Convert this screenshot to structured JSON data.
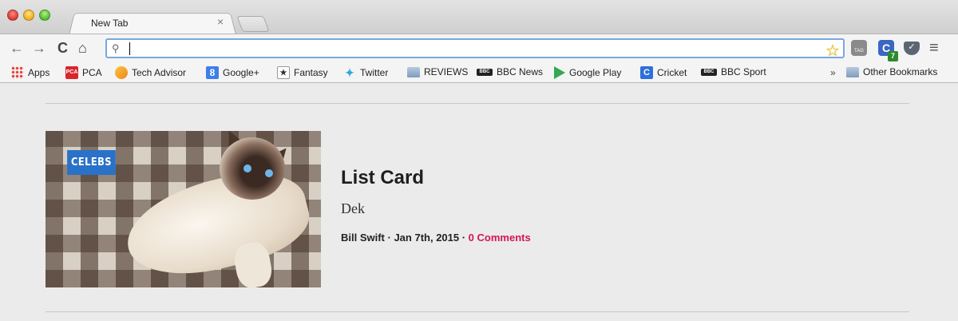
{
  "window": {
    "tab_title": "New Tab",
    "tab_close": "×"
  },
  "toolbar": {
    "back": "←",
    "forward": "→",
    "reload": "C",
    "home": "⌂",
    "search_icon": "⚲",
    "address_value": "",
    "star": "☆",
    "ext_tag_label": "TAG",
    "ext_c_label": "C",
    "ext_c_badge": "7",
    "menu": "≡"
  },
  "bookmarks": {
    "items": [
      {
        "label": "Apps",
        "icon": "apps-grid-icon"
      },
      {
        "label": "PCA",
        "icon": "pca-icon",
        "icon_text": "PCA"
      },
      {
        "label": "Tech Advisor",
        "icon": "tech-advisor-icon"
      },
      {
        "label": "Google+",
        "icon": "google-plus-icon",
        "icon_text": "8"
      },
      {
        "label": "Fantasy",
        "icon": "fantasy-icon",
        "icon_text": "★"
      },
      {
        "label": "Twitter",
        "icon": "twitter-bird-icon",
        "icon_text": "✦"
      },
      {
        "label": "REVIEWS",
        "icon": "folder-icon"
      },
      {
        "label": "BBC News",
        "icon": "bbc-icon",
        "icon_text": "BBC"
      },
      {
        "label": "Google Play",
        "icon": "google-play-icon"
      },
      {
        "label": "Cricket",
        "icon": "cricket-icon",
        "icon_text": "C"
      },
      {
        "label": "BBC Sport",
        "icon": "bbc-icon",
        "icon_text": "BBC"
      }
    ],
    "overflow": "»",
    "other": "Other Bookmarks"
  },
  "card": {
    "category": "CELEBS",
    "title": "List Card",
    "dek": "Dek",
    "author": "Bill Swift",
    "separator": " · ",
    "date": "Jan 7th, 2015",
    "comments": "0 Comments"
  },
  "colors": {
    "accent_badge": "#2a71c8",
    "comments_link": "#d4145a"
  }
}
